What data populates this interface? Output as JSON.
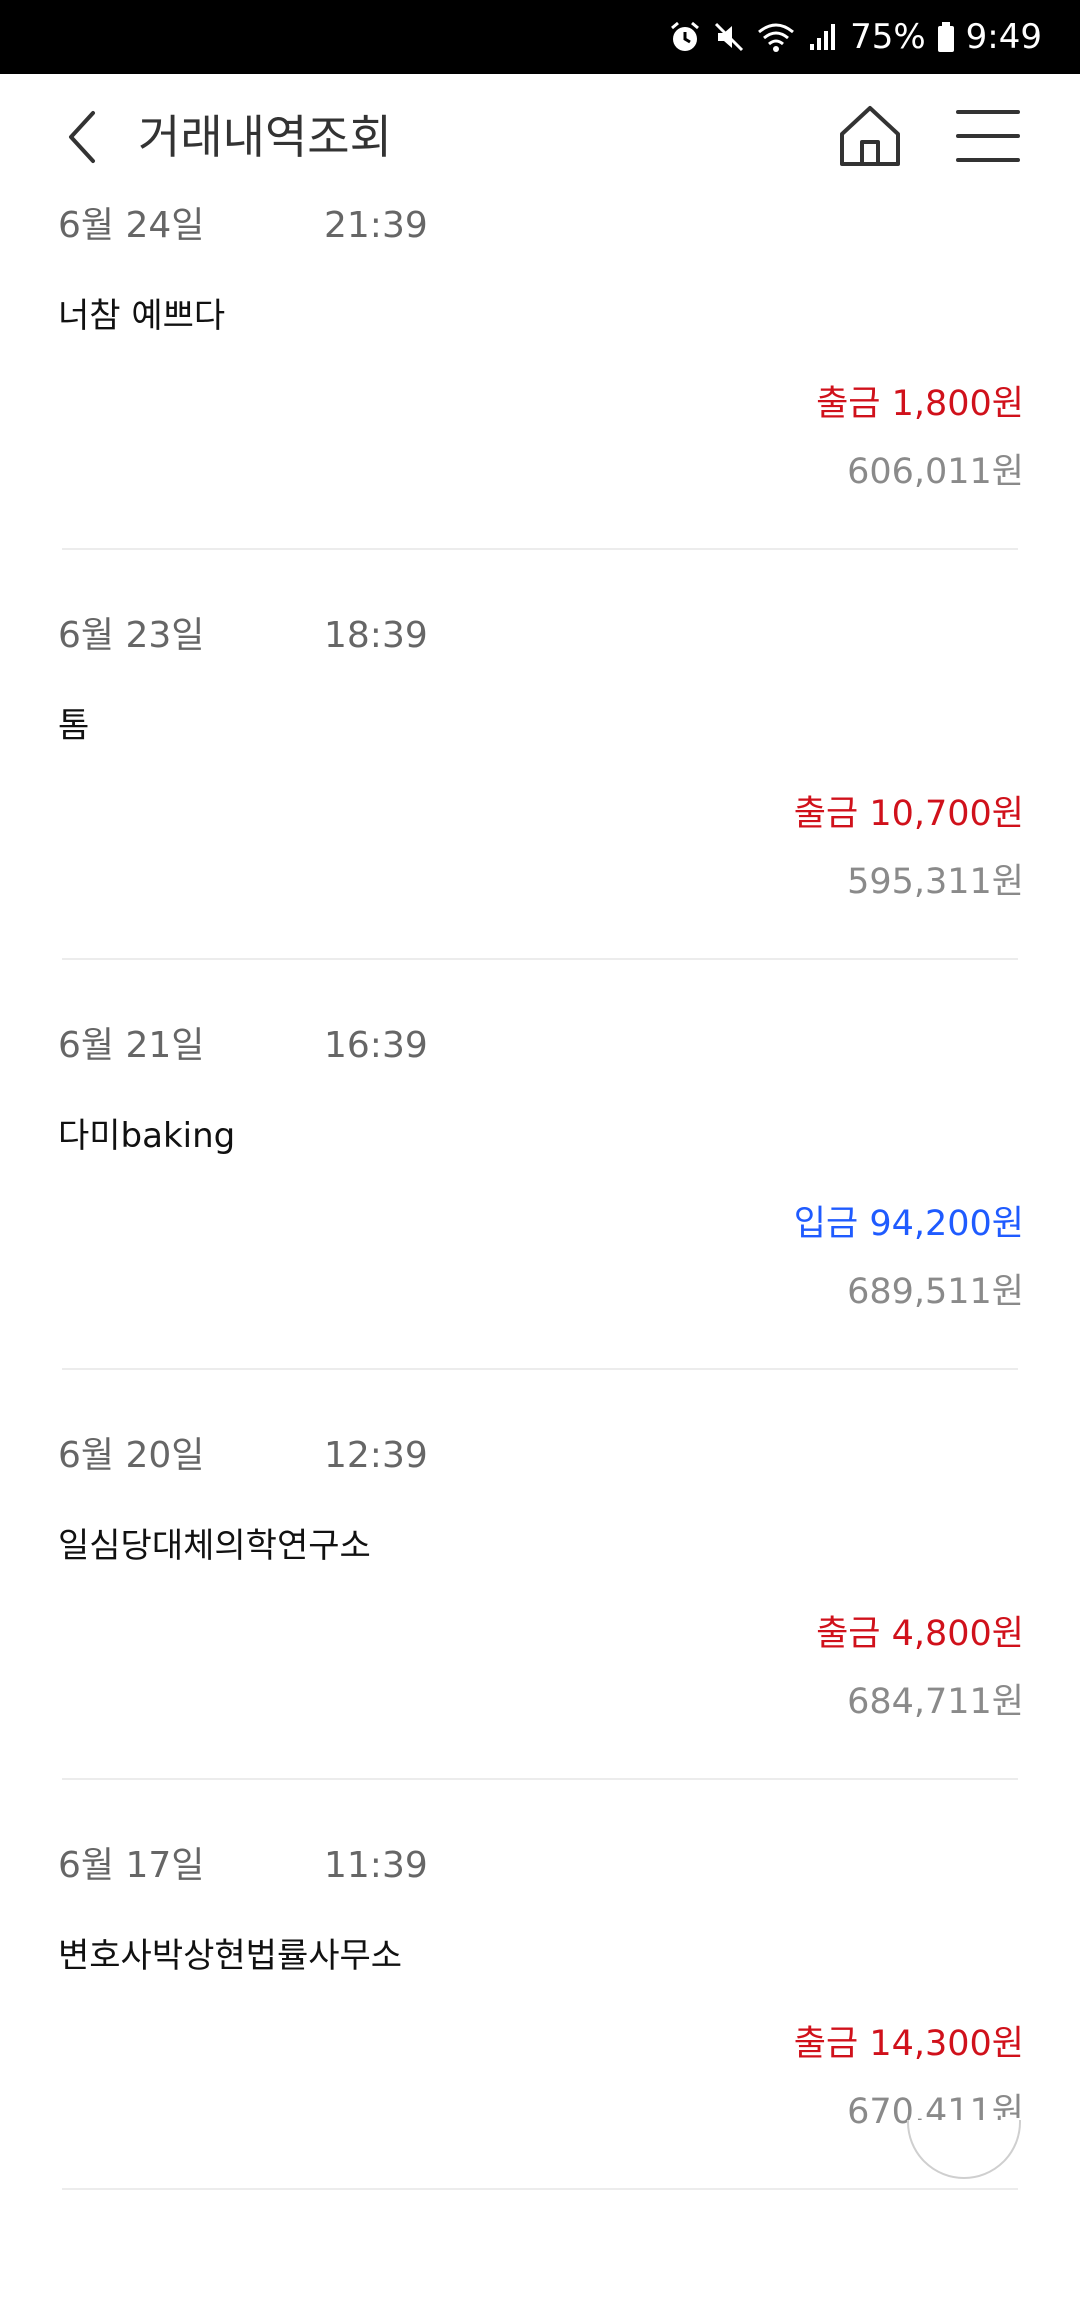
{
  "status_bar": {
    "battery": "75%",
    "time": "9:49",
    "icons": [
      "alarm-icon",
      "mute-icon",
      "wifi-icon",
      "signal-icon",
      "battery-icon"
    ]
  },
  "header": {
    "title": "거래내역조회",
    "icons": [
      "back-arrow-icon",
      "home-icon",
      "hamburger-menu-icon"
    ]
  },
  "colors": {
    "withdraw": "#d0111b",
    "deposit": "#1f5bff",
    "balance": "#8a8a8a"
  },
  "transactions": [
    {
      "date": "6월 24일",
      "time": "21:39",
      "name": "너참 예쁘다",
      "amount": "출금 1,800원",
      "type": "withdraw",
      "balance": "606,011원"
    },
    {
      "date": "6월 23일",
      "time": "18:39",
      "name": "톰",
      "amount": "출금 10,700원",
      "type": "withdraw",
      "balance": "595,311원"
    },
    {
      "date": "6월 21일",
      "time": "16:39",
      "name": "다미baking",
      "amount": "입금 94,200원",
      "type": "deposit",
      "balance": "689,511원"
    },
    {
      "date": "6월 20일",
      "time": "12:39",
      "name": "일심당대체의학연구소",
      "amount": "출금 4,800원",
      "type": "withdraw",
      "balance": "684,711원"
    },
    {
      "date": "6월 17일",
      "time": "11:39",
      "name": "변호사박상현법률사무소",
      "amount": "출금 14,300원",
      "type": "withdraw",
      "balance": "670,411원"
    }
  ]
}
